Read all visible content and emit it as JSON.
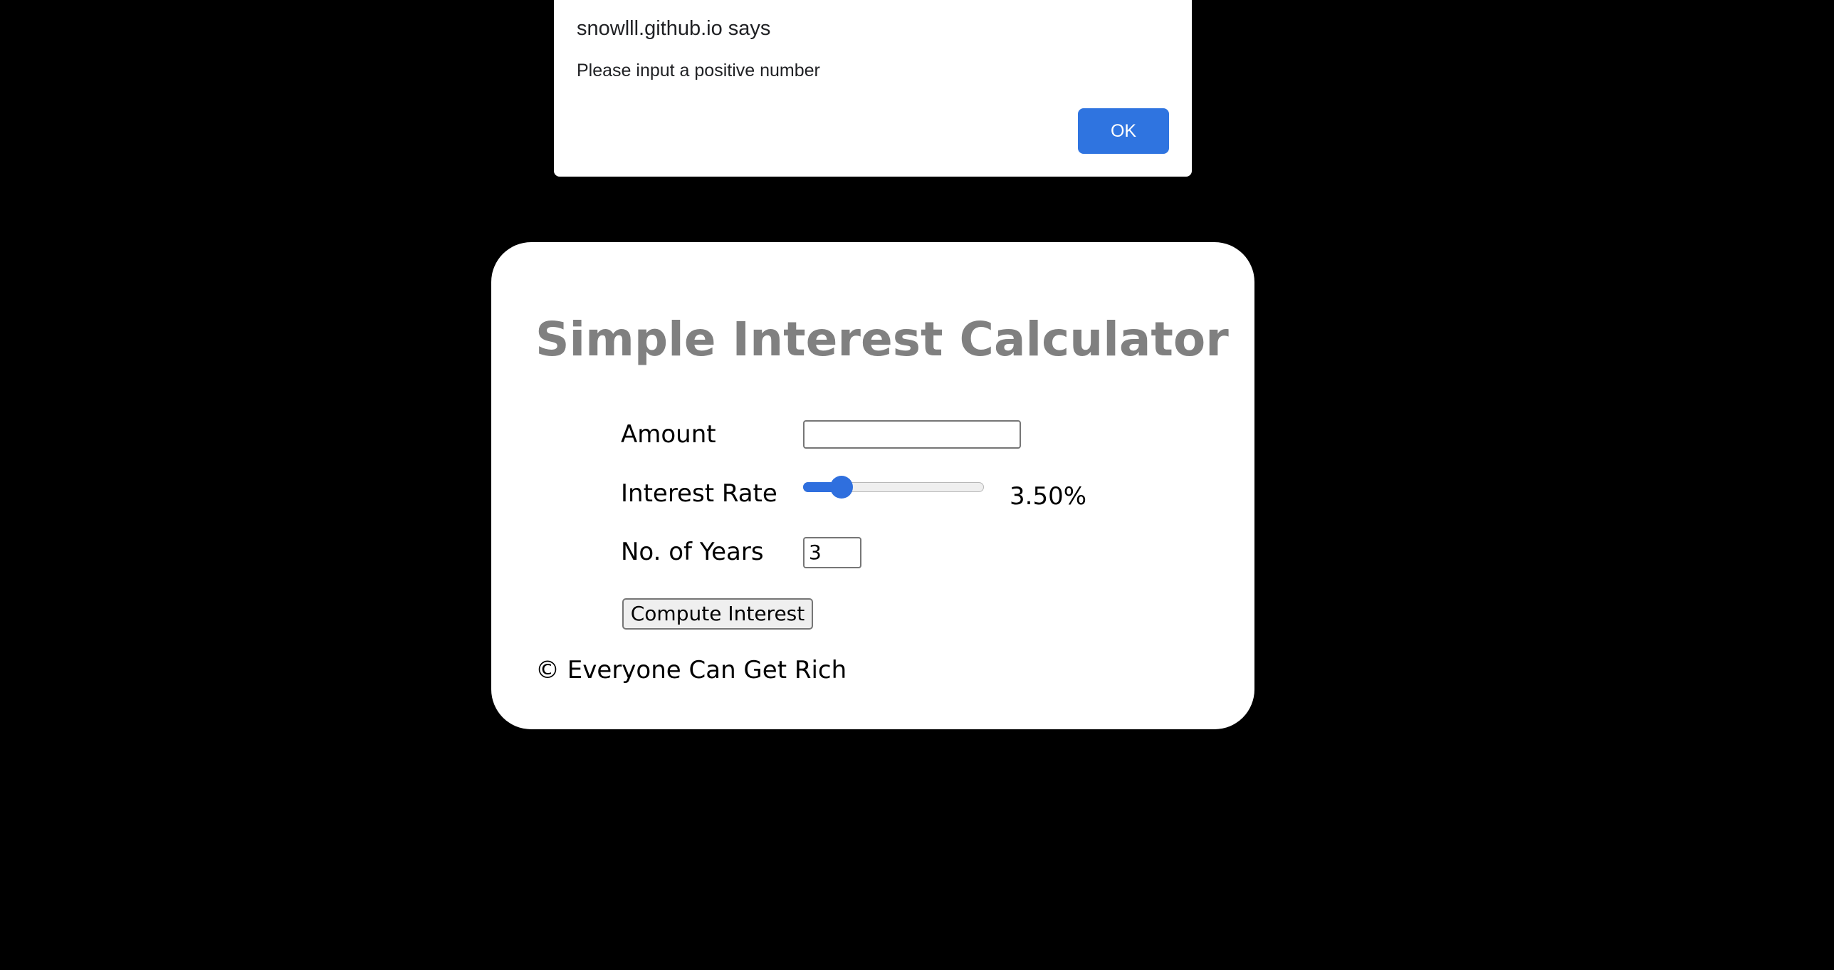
{
  "dialog": {
    "title": "snowlll.github.io says",
    "message": "Please input a positive number",
    "ok_label": "OK"
  },
  "calculator": {
    "title": "Simple Interest Calculator",
    "amount": {
      "label": "Amount",
      "value": ""
    },
    "interest_rate": {
      "label": "Interest Rate",
      "display": "3.50%",
      "slider_fraction": 0.17
    },
    "years": {
      "label": "No. of Years",
      "value": "3"
    },
    "compute_label": "Compute Interest",
    "footer": "© Everyone Can Get Rich"
  },
  "colors": {
    "background": "#000000",
    "card": "#ffffff",
    "title": "#808080",
    "accent": "#2f6fde",
    "ok_button": "#2f74e0"
  }
}
